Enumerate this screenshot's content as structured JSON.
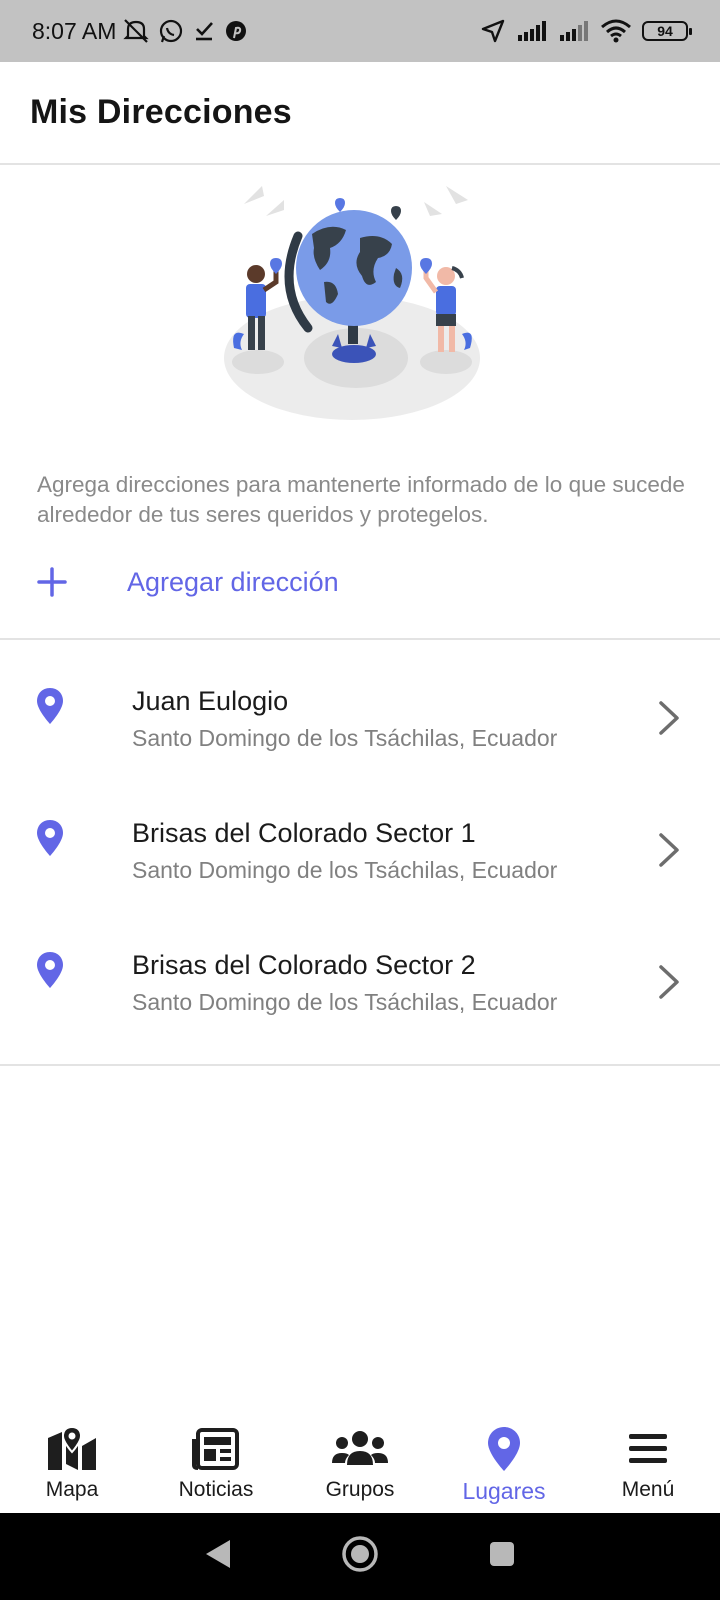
{
  "status_bar": {
    "time": "8:07 AM",
    "battery": "94",
    "left_icons": [
      "mute-icon",
      "whatsapp-icon",
      "checkmark-icon",
      "pinterest-icon"
    ],
    "right_icons": [
      "location-arrow-icon",
      "signal-icon",
      "signal-icon",
      "wifi-icon",
      "battery-icon"
    ]
  },
  "header": {
    "title": "Mis Direcciones"
  },
  "description": "Agrega direcciones para mantenerte informado de lo que sucede alrededor de tus seres queridos y protegelos.",
  "add_address": {
    "label": "Agregar dirección",
    "icon": "plus-icon"
  },
  "addresses": [
    {
      "name": "Juan Eulogio",
      "region": "Santo Domingo de los Tsáchilas,  Ecuador"
    },
    {
      "name": "Brisas del Colorado Sector 1",
      "region": "Santo Domingo de los Tsáchilas,  Ecuador"
    },
    {
      "name": "Brisas del Colorado Sector 2",
      "region": "Santo Domingo de los Tsáchilas,  Ecuador"
    }
  ],
  "bottom_nav": {
    "items": [
      {
        "label": "Mapa",
        "icon": "map-icon"
      },
      {
        "label": "Noticias",
        "icon": "newspaper-icon"
      },
      {
        "label": "Grupos",
        "icon": "users-icon"
      },
      {
        "label": "Lugares",
        "icon": "location-pin-icon",
        "active": true
      },
      {
        "label": "Menú",
        "icon": "menu-icon"
      }
    ]
  },
  "colors": {
    "accent": "#6266e6",
    "text_secondary": "#8a8a8a",
    "status_bar": "#c2c2c2"
  }
}
